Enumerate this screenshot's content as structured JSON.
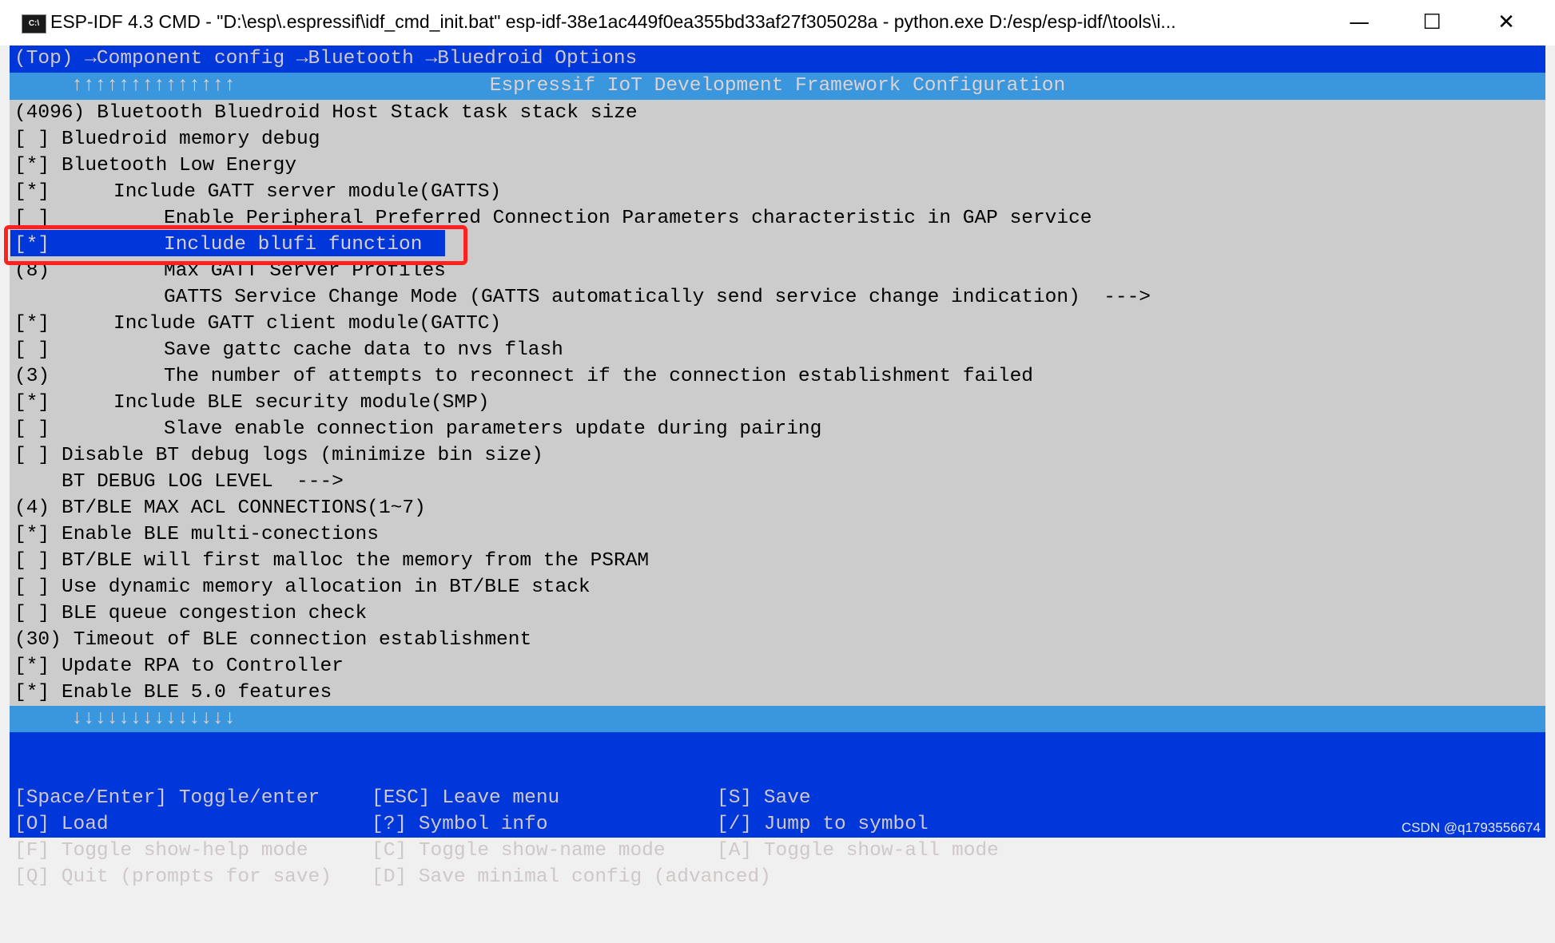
{
  "window": {
    "title": "ESP-IDF 4.3 CMD - \"D:\\esp\\.espressif\\idf_cmd_init.bat\"  esp-idf-38e1ac449f0ea355bd33af27f305028a - python.exe  D:/esp/esp-idf/\\tools\\i...",
    "icon_label": "C:\\",
    "minimize": "—",
    "maximize": "☐",
    "close": "✕"
  },
  "breadcrumb": "(Top) →Component config →Bluetooth →Bluedroid Options",
  "header": {
    "up_arrows": "↑↑↑↑↑↑↑↑↑↑↑↑↑↑",
    "title": "Espressif IoT Development Framework Configuration",
    "down_arrows": "↓↓↓↓↓↓↓↓↓↓↓↓↓↓"
  },
  "rows": [
    {
      "prefix": "(4096)",
      "label": "Bluetooth Bluedroid Host Stack task stack size",
      "level": 0
    },
    {
      "prefix": "[ ]",
      "label": "Bluedroid memory debug",
      "level": 0
    },
    {
      "prefix": "[*]",
      "label": "Bluetooth Low Energy",
      "level": 0
    },
    {
      "prefix": "[*]",
      "label": "Include GATT server module(GATTS)",
      "level": 1
    },
    {
      "prefix": "[ ]",
      "label": "Enable Peripheral Preferred Connection Parameters characteristic in GAP service",
      "level": 2
    },
    {
      "prefix": "[*]",
      "label": "Include blufi function",
      "level": 2,
      "selected": true
    },
    {
      "prefix": "(8)",
      "label": "Max GATT Server Profiles",
      "level": 2
    },
    {
      "prefix": "",
      "label": "GATTS Service Change Mode (GATTS automatically send service change indication)  --->",
      "level": 2
    },
    {
      "prefix": "[*]",
      "label": "Include GATT client module(GATTC)",
      "level": 1
    },
    {
      "prefix": "[ ]",
      "label": "Save gattc cache data to nvs flash",
      "level": 2
    },
    {
      "prefix": "(3)",
      "label": "The number of attempts to reconnect if the connection establishment failed",
      "level": 2
    },
    {
      "prefix": "[*]",
      "label": "Include BLE security module(SMP)",
      "level": 1
    },
    {
      "prefix": "[ ]",
      "label": "Slave enable connection parameters update during pairing",
      "level": 2
    },
    {
      "prefix": "[ ]",
      "label": "Disable BT debug logs (minimize bin size)",
      "level": 0
    },
    {
      "prefix": "",
      "label": "BT DEBUG LOG LEVEL  --->",
      "level": 0
    },
    {
      "prefix": "(4)",
      "label": "BT/BLE MAX ACL CONNECTIONS(1~7)",
      "level": 0
    },
    {
      "prefix": "[*]",
      "label": "Enable BLE multi-conections",
      "level": 0
    },
    {
      "prefix": "[ ]",
      "label": "BT/BLE will first malloc the memory from the PSRAM",
      "level": 0
    },
    {
      "prefix": "[ ]",
      "label": "Use dynamic memory allocation in BT/BLE stack",
      "level": 0
    },
    {
      "prefix": "[ ]",
      "label": "BLE queue congestion check",
      "level": 0
    },
    {
      "prefix": "(30)",
      "label": "Timeout of BLE connection establishment",
      "level": 0
    },
    {
      "prefix": "[*]",
      "label": "Update RPA to Controller",
      "level": 0
    },
    {
      "prefix": "[*]",
      "label": "Enable BLE 5.0 features",
      "level": 0
    }
  ],
  "footer": [
    [
      "[Space/Enter] Toggle/enter",
      "[ESC] Leave menu",
      "[S] Save"
    ],
    [
      "[O] Load",
      "[?] Symbol info",
      "[/] Jump to symbol"
    ],
    [
      "[F] Toggle show-help mode",
      "[C] Toggle show-name mode",
      "[A] Toggle show-all mode"
    ],
    [
      "[Q] Quit (prompts for save)",
      "[D] Save minimal config (advanced)",
      ""
    ]
  ],
  "watermark": "CSDN @q1793556674",
  "colors": {
    "dark_blue": "#0037da",
    "light_blue": "#3a96dd",
    "background": "#cccccc",
    "highlight_box": "#ff2020"
  }
}
